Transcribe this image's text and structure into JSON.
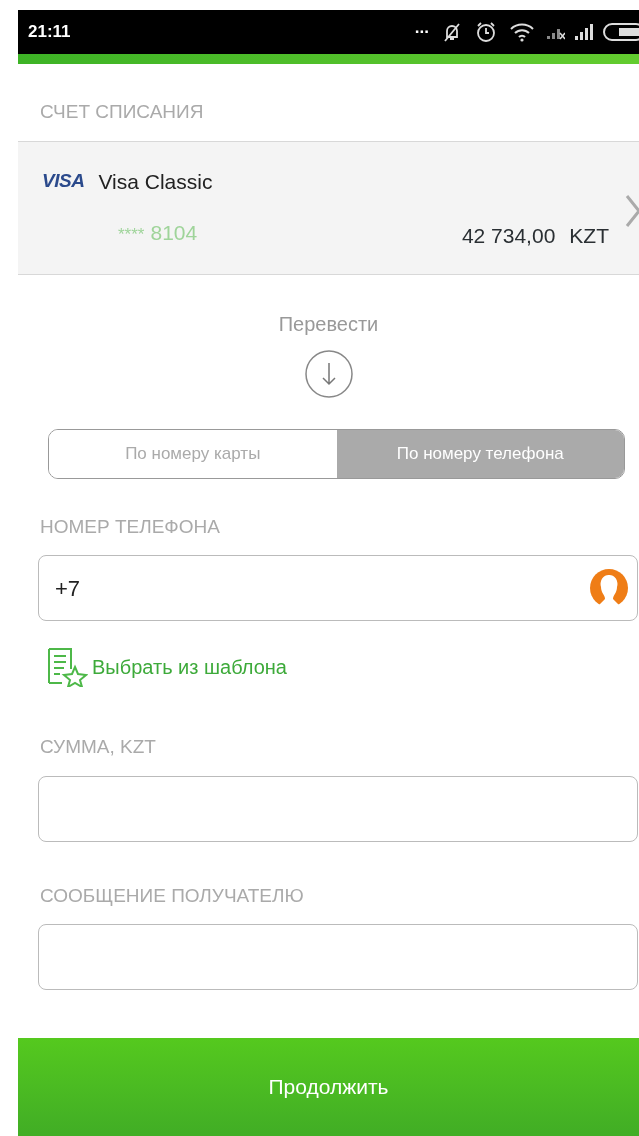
{
  "status_bar": {
    "time": "21:11",
    "dots": "..."
  },
  "source_account": {
    "label": "СЧЕТ СПИСАНИЯ",
    "card": {
      "brand": "VISA",
      "name": "Visa Classic",
      "masked": "****",
      "last_digits": "8104",
      "balance": "42 734,00",
      "currency": "KZT"
    }
  },
  "transfer_label": "Перевести",
  "mode_tabs": [
    {
      "label": "По номеру карты",
      "selected": false
    },
    {
      "label": "По номеру телефона",
      "selected": true
    }
  ],
  "phone_field": {
    "label": "НОМЕР ТЕЛЕФОНА",
    "value": "+7"
  },
  "template_link": "Выбрать из шаблона",
  "fields": [
    {
      "label": "СУММА, KZT"
    },
    {
      "label": "СООБЩЕНИЕ ПОЛУЧАТЕЛЮ"
    }
  ],
  "submit_button": "Продолжить"
}
